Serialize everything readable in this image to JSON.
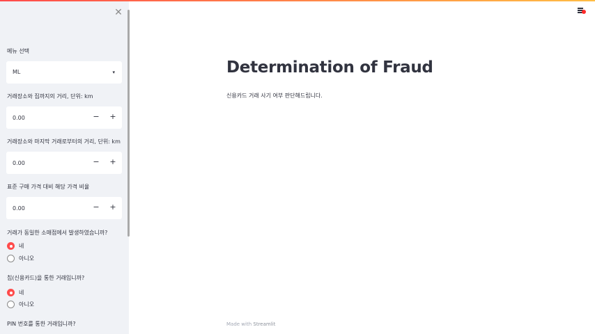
{
  "sidebar": {
    "menu_label": "메뉴 선택",
    "menu_value": "ML",
    "fields": [
      {
        "label": "거래장소와 집까지의 거리, 단위: km",
        "value": "0.00"
      },
      {
        "label": "거래장소와 마지막 거래로부터의 거리, 단위: km",
        "value": "0.00"
      },
      {
        "label": "표준 구매 가격 대비 해당 가격 비율",
        "value": "0.00"
      }
    ],
    "radio_groups": [
      {
        "label": "거래가 동일한 소매점에서 발생하였습니까?",
        "options": [
          "네",
          "아니오"
        ],
        "selected": 0
      },
      {
        "label": "칩(신용카드)을 통한 거래입니까?",
        "options": [
          "네",
          "아니오"
        ],
        "selected": 0
      }
    ],
    "last_label": "PIN 번호를 통한 거래입니까?",
    "minus": "−",
    "plus": "+",
    "close_glyph": "✕",
    "caret_glyph": "▾"
  },
  "main": {
    "title": "Determination of Fraud",
    "subtitle": "신용카드 거래 사기 여부 판단해드립니다.",
    "footer_prefix": "Made with ",
    "footer_brand": "Streamlit"
  },
  "colors": {
    "accent": "#ff4b4b",
    "sidebar_bg": "#f0f2f6",
    "text": "#31333f"
  }
}
